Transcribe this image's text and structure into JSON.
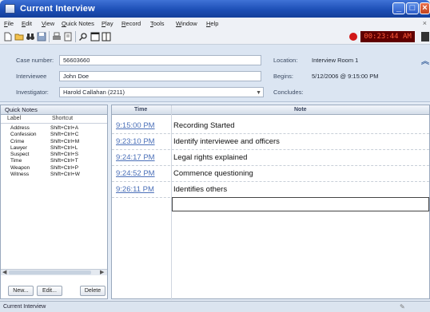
{
  "window": {
    "title": "Current Interview"
  },
  "menu": [
    {
      "u": "F",
      "rest": "ile"
    },
    {
      "u": "E",
      "rest": "dit"
    },
    {
      "u": "V",
      "rest": "iew"
    },
    {
      "u": "Q",
      "rest": "uick Notes"
    },
    {
      "u": "P",
      "rest": "lay"
    },
    {
      "u": "R",
      "rest": "ecord"
    },
    {
      "u": "T",
      "rest": "ools"
    },
    {
      "u": "W",
      "rest": "indow"
    },
    {
      "u": "H",
      "rest": "elp"
    }
  ],
  "toolbar": {
    "icons": [
      "new-document-icon",
      "open-folder-icon",
      "binoculars-icon",
      "save-icon",
      "print-icon",
      "page-setup-icon",
      "search-icon",
      "split-view-icon",
      "layout-icon"
    ],
    "timer": "00:23:44 AM"
  },
  "header": {
    "case_label": "Case number:",
    "case_value": "56603660",
    "interviewee_label": "Interviewee",
    "interviewee_value": "John Doe",
    "investigator_label": "Investigator:",
    "investigator_value": "Harold Callahan (2211)",
    "location_label": "Location:",
    "location_value": "Interview Room 1",
    "begins_label": "Begins:",
    "begins_value": "5/12/2006 @ 9:15:00 PM",
    "concludes_label": "Concludes:",
    "concludes_value": ""
  },
  "quick_notes": {
    "title": "Quick Notes",
    "col_label": "Label",
    "col_shortcut": "Shortcut",
    "items": [
      {
        "label": "Address",
        "shortcut": "Shift+Ctrl+A"
      },
      {
        "label": "Confession",
        "shortcut": "Shift+Ctrl+C"
      },
      {
        "label": "Crime",
        "shortcut": "Shift+Ctrl+M"
      },
      {
        "label": "Lawyer",
        "shortcut": "Shift+Ctrl+L"
      },
      {
        "label": "Suspect",
        "shortcut": "Shift+Ctrl+S"
      },
      {
        "label": "Time",
        "shortcut": "Shift+Ctrl+T"
      },
      {
        "label": "Weapon",
        "shortcut": "Shift+Ctrl+P"
      },
      {
        "label": "Witness",
        "shortcut": "Shift+Ctrl+W"
      }
    ],
    "new_label": "New...",
    "edit_label": "Edit...",
    "delete_label": "Delete"
  },
  "notes": {
    "col_time": "Time",
    "col_note": "Note",
    "rows": [
      {
        "time": "9:15:00 PM",
        "note": "Recording Started"
      },
      {
        "time": "9:23:10 PM",
        "note": "Identify interviewee and officers"
      },
      {
        "time": "9:24:17 PM",
        "note": "Legal rights explained"
      },
      {
        "time": "9:24:52 PM",
        "note": "Commence questioning"
      },
      {
        "time": "9:26:11 PM",
        "note": "Identifies others"
      }
    ]
  },
  "status": {
    "text": "Current Interview"
  }
}
